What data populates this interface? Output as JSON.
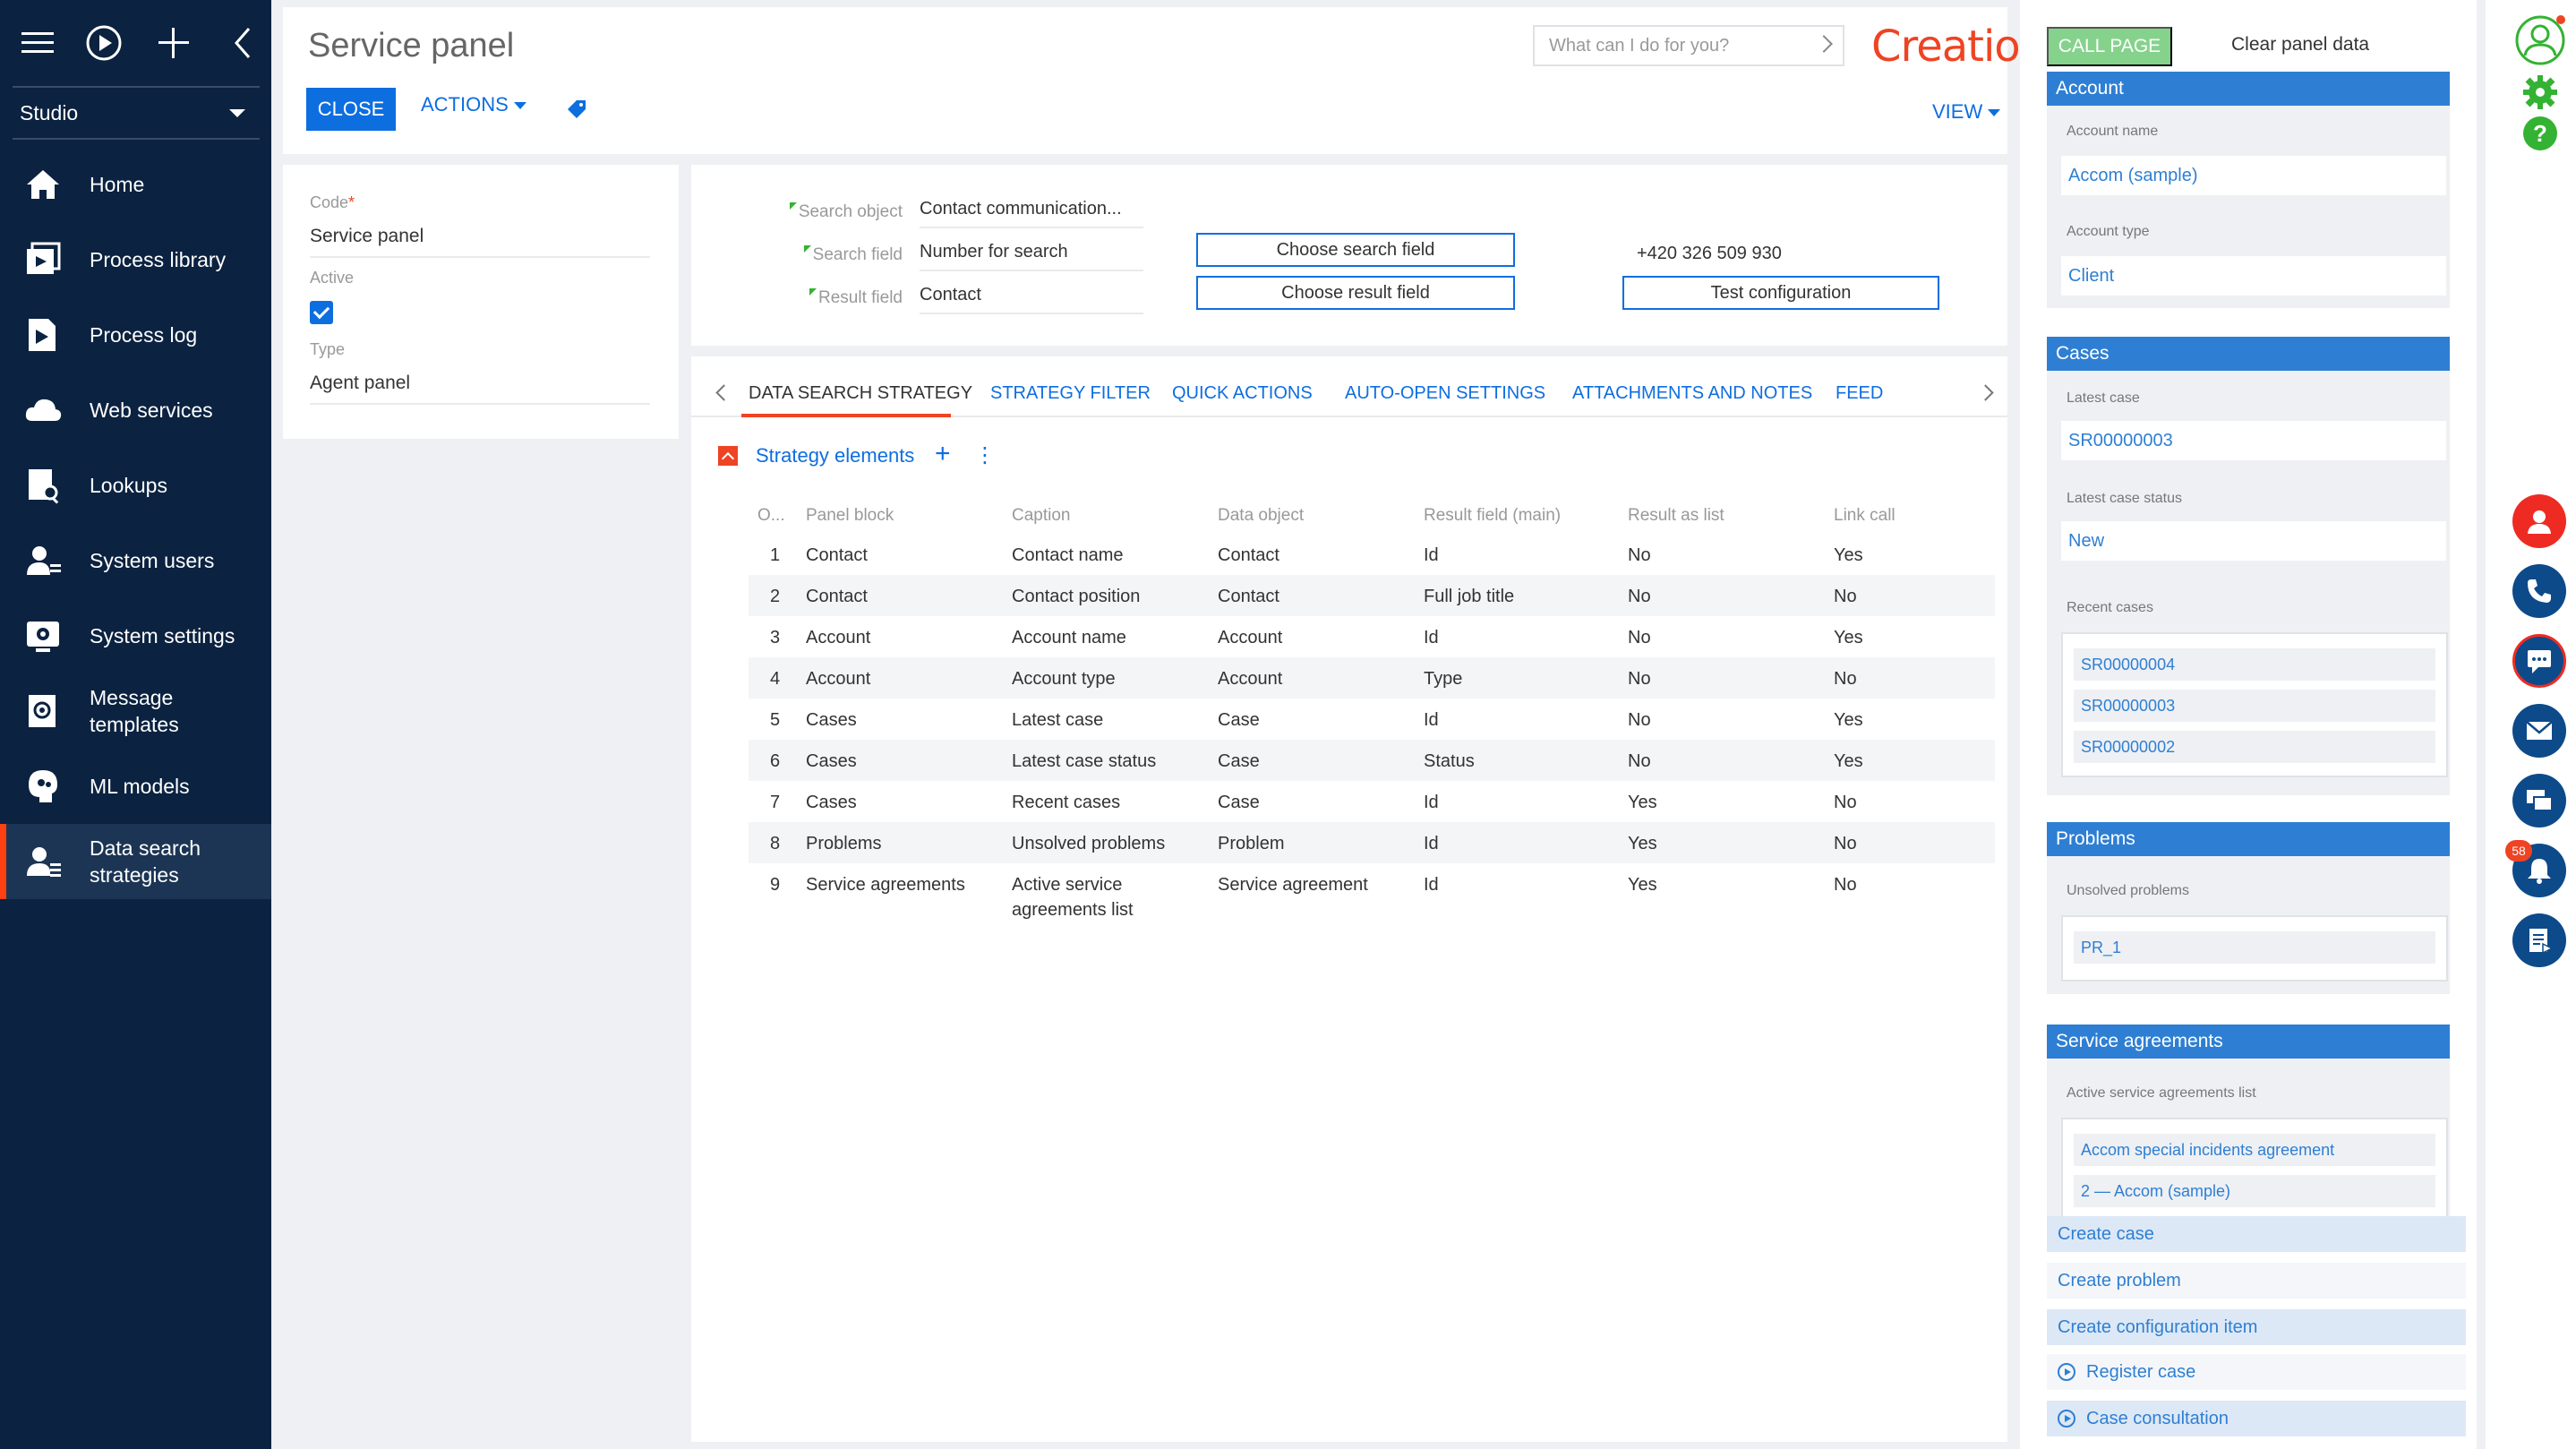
{
  "sidebar": {
    "studio_label": "Studio",
    "items": [
      {
        "label": "Home"
      },
      {
        "label": "Process library"
      },
      {
        "label": "Process log"
      },
      {
        "label": "Web services"
      },
      {
        "label": "Lookups"
      },
      {
        "label": "System users"
      },
      {
        "label": "System settings"
      },
      {
        "label": "Message templates"
      },
      {
        "label": "ML models"
      },
      {
        "label": "Data search strategies"
      }
    ]
  },
  "header": {
    "title": "Service panel",
    "close_label": "CLOSE",
    "actions_label": "ACTIONS",
    "view_label": "VIEW",
    "search_placeholder": "What can I do for you?",
    "logo_text": "Creatio"
  },
  "fields": {
    "code_label": "Code",
    "code_required": "*",
    "code_value": "Service panel",
    "active_label": "Active",
    "active_checked": true,
    "type_label": "Type",
    "type_value": "Agent panel"
  },
  "config": {
    "search_object_label": "Search object",
    "search_object_value": "Contact communication...",
    "search_field_label": "Search field",
    "search_field_value": "Number for search",
    "result_field_label": "Result field",
    "result_field_value": "Contact",
    "choose_search_label": "Choose search field",
    "choose_result_label": "Choose result field",
    "phone_value": "+420 326 509 930",
    "test_config_label": "Test configuration"
  },
  "tabs": [
    {
      "label": "DATA SEARCH STRATEGY"
    },
    {
      "label": "STRATEGY FILTER"
    },
    {
      "label": "QUICK ACTIONS"
    },
    {
      "label": "AUTO-OPEN SETTINGS"
    },
    {
      "label": "ATTACHMENTS AND NOTES"
    },
    {
      "label": "FEED"
    }
  ],
  "detail": {
    "title": "Strategy elements",
    "plus": "+",
    "kebab": "⋮",
    "columns": [
      "O...",
      "Panel block",
      "Caption",
      "Data object",
      "Result field (main)",
      "Result as list",
      "Link call"
    ],
    "rows": [
      [
        "1",
        "Contact",
        "Contact name",
        "Contact",
        "Id",
        "No",
        "Yes"
      ],
      [
        "2",
        "Contact",
        "Contact position",
        "Contact",
        "Full job title",
        "No",
        "No"
      ],
      [
        "3",
        "Account",
        "Account name",
        "Account",
        "Id",
        "No",
        "Yes"
      ],
      [
        "4",
        "Account",
        "Account type",
        "Account",
        "Type",
        "No",
        "No"
      ],
      [
        "5",
        "Cases",
        "Latest case",
        "Case",
        "Id",
        "No",
        "Yes"
      ],
      [
        "6",
        "Cases",
        "Latest case status",
        "Case",
        "Status",
        "No",
        "Yes"
      ],
      [
        "7",
        "Cases",
        "Recent cases",
        "Case",
        "Id",
        "Yes",
        "No"
      ],
      [
        "8",
        "Problems",
        "Unsolved problems",
        "Problem",
        "Id",
        "Yes",
        "No"
      ],
      [
        "9",
        "Service agreements",
        "Active service agreements list",
        "Service agreement",
        "Id",
        "Yes",
        "No"
      ]
    ]
  },
  "panel": {
    "call_page_label": "CALL PAGE",
    "clear_label": "Clear panel data",
    "account": {
      "header": "Account",
      "name_label": "Account name",
      "name_value": "Accom (sample)",
      "type_label": "Account type",
      "type_value": "Client"
    },
    "cases": {
      "header": "Cases",
      "latest_label": "Latest case",
      "latest_value": "SR00000003",
      "status_label": "Latest case status",
      "status_value": "New",
      "recent_label": "Recent cases",
      "recent": [
        "SR00000004",
        "SR00000003",
        "SR00000002"
      ]
    },
    "problems": {
      "header": "Problems",
      "unsolved_label": "Unsolved problems",
      "items": [
        "PR_1"
      ]
    },
    "agreements": {
      "header": "Service agreements",
      "list_label": "Active service agreements list",
      "items": [
        "Accom special incidents agreement",
        "2 — Accom (sample)"
      ]
    },
    "quick_actions": [
      {
        "label": "Create case"
      },
      {
        "label": "Create problem"
      },
      {
        "label": "Create configuration item"
      },
      {
        "label": "Register case"
      },
      {
        "label": "Case consultation"
      }
    ]
  },
  "strip": {
    "notification_count": "58"
  },
  "colors": {
    "sidebar_bg": "#0b2240",
    "accent_blue": "#0d6ee0",
    "brand_orange": "#ee4423",
    "panel_header_blue": "#2e7fd3",
    "call_page_green": "#85d28c"
  }
}
